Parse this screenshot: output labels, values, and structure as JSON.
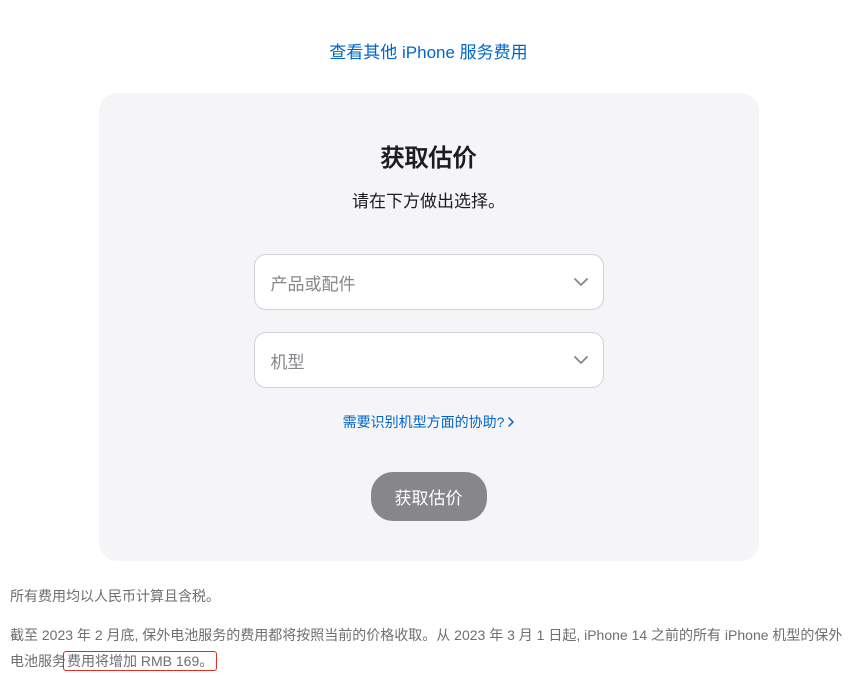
{
  "topLink": "查看其他 iPhone 服务费用",
  "card": {
    "title": "获取估价",
    "subtitle": "请在下方做出选择。",
    "select1Placeholder": "产品或配件",
    "select2Placeholder": "机型",
    "helpLink": "需要识别机型方面的协助?",
    "submitLabel": "获取估价"
  },
  "footer": {
    "para1": "所有费用均以人民币计算且含税。",
    "para2_pre": "截至 2023 年 2 月底, 保外电池服务的费用都将按照当前的价格收取。从 2023 年 3 月 1 日起, iPhone 14 之前的所有 iPhone 机型的保外电池服务",
    "para2_highlight": "费用将增加 RMB 169。"
  }
}
